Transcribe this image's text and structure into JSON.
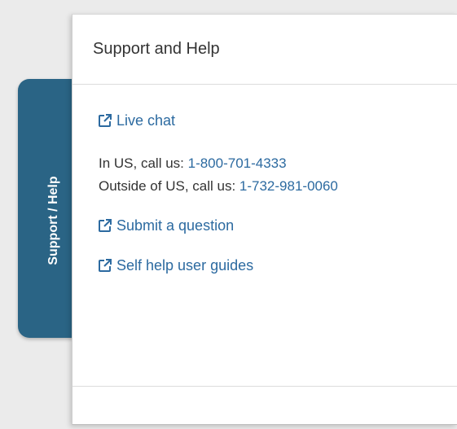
{
  "side_tab": {
    "label": "Support / Help"
  },
  "panel": {
    "title": "Support and Help",
    "live_chat_label": "Live chat",
    "call_us": {
      "prefix": "In US, call us: ",
      "number": "1-800-701-4333"
    },
    "call_outside": {
      "prefix": "Outside of US, call us: ",
      "number": "1-732-981-0060"
    },
    "submit_question_label": "Submit a question",
    "self_help_label": "Self help user guides"
  },
  "colors": {
    "tab_background": "#2a6485",
    "link": "#2c6aa0",
    "text": "#333333",
    "page_background": "#ebebeb"
  },
  "icons": {
    "link_icon": "external-link-icon"
  }
}
